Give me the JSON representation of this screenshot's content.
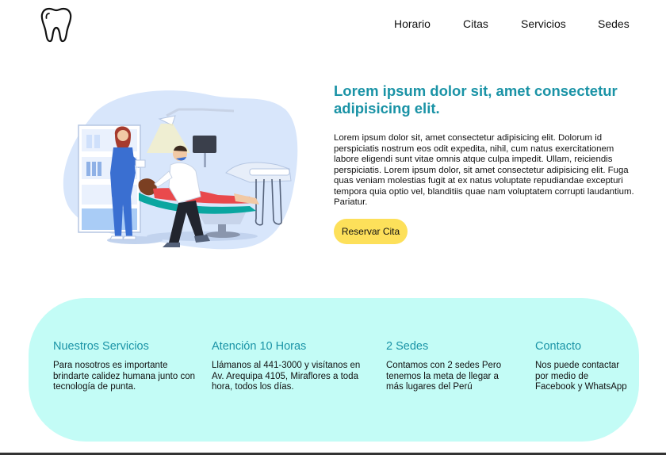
{
  "nav": {
    "items": [
      "Horario",
      "Citas",
      "Servicios",
      "Sedes"
    ]
  },
  "icons": {
    "logo": "tooth-icon"
  },
  "hero": {
    "title": "Lorem ipsum dolor sit, amet consectetur adipisicing elit.",
    "text": "Lorem ipsum dolor sit, amet consectetur adipisicing elit. Dolorum id perspiciatis nostrum eos odit expedita, nihil, cum natus exercitationem labore eligendi sunt vitae omnis atque culpa impedit. Ullam, reiciendis perspiciatis. Lorem ipsum dolor, sit amet consectetur adipisicing elit. Fuga quas veniam molestias fugit at ex natus voluptate repudiandae excepturi tempora quia optio vel, blanditiis quae nam voluptatem corrupti laudantium. Pariatur.",
    "cta_label": "Reservar Cita"
  },
  "services": [
    {
      "title": "Nuestros Servicios",
      "text": "Para nosotros es importante brindarte calidez humana junto con tecnología de punta."
    },
    {
      "title": "Atención 10 Horas",
      "text": "Llámanos al 441-3000 y visítanos en Av. Arequipa 4105, Miraflores a toda hora, todos los días."
    },
    {
      "title": "2 Sedes",
      "text": "Contamos con 2 sedes Pero tenemos la meta de llegar a más lugares del Perú"
    },
    {
      "title": "Contacto",
      "text": "Nos puede contactar por medio de Facebook y WhatsApp"
    }
  ],
  "colors": {
    "accent": "#1a93a6",
    "cta": "#fde05a",
    "panel": "#c3fcf6"
  }
}
